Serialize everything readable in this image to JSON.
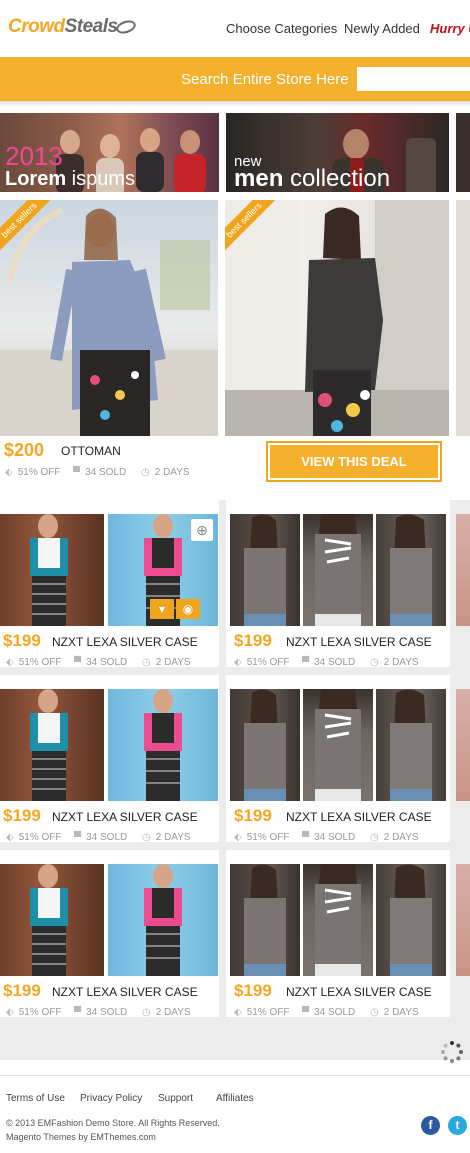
{
  "header": {
    "logo_part1": "Crowd",
    "logo_part2": "Steals",
    "nav": [
      "Choose Categories",
      "Newly Added",
      "Hurry U"
    ]
  },
  "search": {
    "label": "Search Entire Store Here",
    "placeholder": ""
  },
  "banners": [
    {
      "year": "2013",
      "text_bold": "Lorem",
      "text_light": " ispums"
    },
    {
      "small": "new",
      "text_bold": "men",
      "text_light": " collection"
    }
  ],
  "featured": [
    {
      "ribbon": "best sellers",
      "price": "$200",
      "title": "OTTOMAN",
      "discount": "51% OFF",
      "sold": "34 SOLD",
      "days": "2 DAYS"
    },
    {
      "ribbon": "best sellers",
      "cta": "VIEW THIS DEAL"
    }
  ],
  "grid": [
    {
      "price": "$199",
      "title": "NZXT LEXA SILVER  CASE",
      "discount": "51% OFF",
      "sold": "34 SOLD",
      "days": "2 DAYS"
    },
    {
      "price": "$199",
      "title": "NZXT LEXA SILVER  CASE",
      "discount": "51% OFF",
      "sold": "34 SOLD",
      "days": "2 DAYS"
    },
    {
      "price": "$199",
      "title": "NZXT LEXA SILVER  CASE",
      "discount": "51% OFF",
      "sold": "34 SOLD",
      "days": "2 DAYS"
    },
    {
      "price": "$199",
      "title": "NZXT LEXA SILVER  CASE",
      "discount": "51% OFF",
      "sold": "34 SOLD",
      "days": "2 DAYS"
    },
    {
      "price": "$199",
      "title": "NZXT LEXA SILVER  CASE",
      "discount": "51% OFF",
      "sold": "34 SOLD",
      "days": "2 DAYS"
    },
    {
      "price": "$199",
      "title": "NZXT LEXA SILVER  CASE",
      "discount": "51% OFF",
      "sold": "34 SOLD",
      "days": "2 DAYS"
    }
  ],
  "icons": {
    "tag": "tag-icon",
    "cart": "cart-icon",
    "clock": "clock-icon",
    "zoom": "zoom-icon",
    "basket": "basket-icon",
    "eye": "eye-icon"
  },
  "footer": {
    "links": [
      "Terms of Use",
      "Privacy Policy",
      "Support",
      "Affiliates"
    ],
    "copyright": "© 2013 EMFashion Demo Store. All Rights Reserved.",
    "credit": "Magento Themes by EMThemes.com"
  },
  "colors": {
    "accent": "#f5a623",
    "bar": "#f5b02e",
    "hurry": "#c0141a",
    "facebook": "#2c5aa0",
    "twitter": "#2aa8e0"
  }
}
